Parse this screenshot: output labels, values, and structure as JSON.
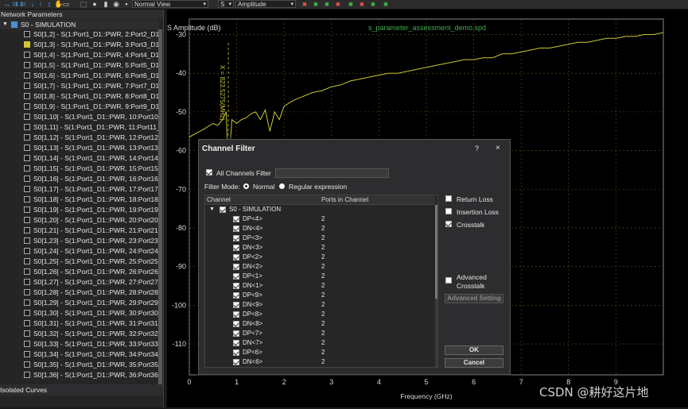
{
  "toolbar": {
    "icons": [
      "arrows-left-right-icon",
      "arrows-right-icon",
      "arrows-left-icon",
      "arrow-down-icon",
      "arrow-up-icon",
      "arrow-up-down-icon",
      "hand-icon",
      "select-box-icon",
      "zoom-box-icon",
      "camera-icon",
      "chart-icon",
      "plot-icon",
      "marker-icon",
      "layout-icon",
      "table-icon",
      "export-icon"
    ],
    "view_select": "Normal View",
    "param_select": "S",
    "measure_select": "Amplitude"
  },
  "left_panel": {
    "title": "Network Parameters",
    "root_label": "S0 - SIMULATION",
    "items": [
      {
        "label": "S0[1,2] - S(1:Port1_D1::PWR, 2:Port2_D1_...",
        "checked": false
      },
      {
        "label": "S0[1,3] - S(1:Port1_D1::PWR, 3:Port3_D1_...",
        "checked": true
      },
      {
        "label": "S0[1,4] - S(1:Port1_D1::PWR, 4:Port4_D1_...",
        "checked": false
      },
      {
        "label": "S0[1,5] - S(1:Port1_D1::PWR, 5:Port5_D1_...",
        "checked": false
      },
      {
        "label": "S0[1,6] - S(1:Port1_D1::PWR, 6:Port6_D1_...",
        "checked": false
      },
      {
        "label": "S0[1,7] - S(1:Port1_D1::PWR, 7:Port7_D1_...",
        "checked": false
      },
      {
        "label": "S0[1,8] - S(1:Port1_D1::PWR, 8:Port8_D1_...",
        "checked": false
      },
      {
        "label": "S0[1,9] - S(1:Port1_D1::PWR, 9:Port9_D1_...",
        "checked": false
      },
      {
        "label": "S0[1,10] - S(1:Port1_D1::PWR, 10:Port10_...",
        "checked": false
      },
      {
        "label": "S0[1,11] - S(1:Port1_D1::PWR, 11:Port11_...",
        "checked": false
      },
      {
        "label": "S0[1,12] - S(1:Port1_D1::PWR, 12:Port12_...",
        "checked": false
      },
      {
        "label": "S0[1,13] - S(1:Port1_D1::PWR, 13:Port13_...",
        "checked": false
      },
      {
        "label": "S0[1,14] - S(1:Port1_D1::PWR, 14:Port14_...",
        "checked": false
      },
      {
        "label": "S0[1,15] - S(1:Port1_D1::PWR, 15:Port15_...",
        "checked": false
      },
      {
        "label": "S0[1,16] - S(1:Port1_D1::PWR, 16:Port16_...",
        "checked": false
      },
      {
        "label": "S0[1,17] - S(1:Port1_D1::PWR, 17:Port17_...",
        "checked": false
      },
      {
        "label": "S0[1,18] - S(1:Port1_D1::PWR, 18:Port18_...",
        "checked": false
      },
      {
        "label": "S0[1,19] - S(1:Port1_D1::PWR, 19:Port19_...",
        "checked": false
      },
      {
        "label": "S0[1,20] - S(1:Port1_D1::PWR, 20:Port20_...",
        "checked": false
      },
      {
        "label": "S0[1,21] - S(1:Port1_D1::PWR, 21:Port21_...",
        "checked": false
      },
      {
        "label": "S0[1,23] - S(1:Port1_D1::PWR, 23:Port23_...",
        "checked": false
      },
      {
        "label": "S0[1,24] - S(1:Port1_D1::PWR, 24:Port24_...",
        "checked": false
      },
      {
        "label": "S0[1,25] - S(1:Port1_D1::PWR, 25:Port25_...",
        "checked": false
      },
      {
        "label": "S0[1,26] - S(1:Port1_D1::PWR, 26:Port26_...",
        "checked": false
      },
      {
        "label": "S0[1,27] - S(1:Port1_D1::PWR, 27:Port27_...",
        "checked": false
      },
      {
        "label": "S0[1,28] - S(1:Port1_D1::PWR, 28:Port28_...",
        "checked": false
      },
      {
        "label": "S0[1,29] - S(1:Port1_D1::PWR, 29:Port29_...",
        "checked": false
      },
      {
        "label": "S0[1,30] - S(1:Port1_D1::PWR, 30:Port30_...",
        "checked": false
      },
      {
        "label": "S0[1,31] - S(1:Port1_D1::PWR, 31:Port31_...",
        "checked": false
      },
      {
        "label": "S0[1,32] - S(1:Port1_D1::PWR, 32:Port32_...",
        "checked": false
      },
      {
        "label": "S0[1,33] - S(1:Port1_D1::PWR, 33:Port33_...",
        "checked": false
      },
      {
        "label": "S0[1,34] - S(1:Port1_D1::PWR, 34:Port34_...",
        "checked": false
      },
      {
        "label": "S0[1,35] - S(1:Port1_D1::PWR, 35:Port35_...",
        "checked": false
      },
      {
        "label": "S0[1,36] - S(1:Port1_D1::PWR, 36:Port36_...",
        "checked": false
      }
    ],
    "isolated_title": "Isolated Curves"
  },
  "plot": {
    "ylabel": "S Amplitude (dB)",
    "xlabel": "Frequency (GHz)",
    "file_title": "s_parameter_assessment_demo.spd",
    "marker_label": "X = 823.5275(MHz)"
  },
  "chart_data": {
    "type": "line",
    "title": "s_parameter_assessment_demo.spd",
    "xlabel": "Frequency (GHz)",
    "ylabel": "S Amplitude (dB)",
    "xlim": [
      0,
      10
    ],
    "ylim": [
      -118,
      -26
    ],
    "x_ticks": [
      0,
      1,
      2,
      3,
      4,
      5,
      6,
      7,
      8,
      9
    ],
    "y_ticks": [
      -30,
      -40,
      -50,
      -60,
      -70,
      -80,
      -90,
      -100,
      -110
    ],
    "grid": true,
    "marker_x": 0.8235,
    "series": [
      {
        "color": "#c8c832",
        "x": [
          0.0,
          0.3,
          0.5,
          0.6,
          0.7,
          0.78,
          0.82,
          0.9,
          1.0,
          1.1,
          1.2,
          1.3,
          1.4,
          1.5,
          1.6,
          1.7,
          1.8,
          1.9,
          2.0,
          2.2,
          2.4,
          2.6,
          2.8,
          3.0,
          3.2,
          3.4,
          3.6,
          3.8,
          4.0,
          4.2,
          4.4,
          4.6,
          4.8,
          5.0,
          5.2,
          5.4,
          5.6,
          5.8,
          6.0,
          6.2,
          6.4,
          6.6,
          6.8,
          7.0,
          7.2,
          7.4,
          7.6,
          7.8,
          8.0,
          8.2,
          8.4,
          8.6,
          8.8,
          9.0,
          9.2,
          9.4,
          9.6,
          9.8,
          10.0
        ],
        "values": [
          -56.5,
          -54.5,
          -53,
          -53.5,
          -52,
          -50,
          -66,
          -52,
          -53,
          -52,
          -51.5,
          -50.5,
          -50,
          -52,
          -49.5,
          -55,
          -50,
          -52,
          -48.5,
          -47,
          -46,
          -45,
          -44.5,
          -43.5,
          -43,
          -42,
          -41.5,
          -41,
          -40.5,
          -40,
          -40,
          -39.5,
          -39,
          -38.5,
          -38,
          -37.5,
          -37,
          -36.5,
          -36.5,
          -36,
          -36,
          -35,
          -35,
          -34.5,
          -34,
          -33.5,
          -33.5,
          -33,
          -32.5,
          -32,
          -32,
          -31.5,
          -31,
          -31,
          -30.5,
          -30.5,
          -30,
          -30,
          -29.5
        ]
      }
    ]
  },
  "dialog": {
    "title": "Channel Filter",
    "help": "?",
    "close": "×",
    "all_channels_label": "All Channels",
    "all_channels_checked": true,
    "filter_label": "Filter",
    "filter_value": "",
    "filter_mode_label": "Filter Mode:",
    "mode_normal": "Normal",
    "mode_regex": "Regular expression",
    "col_channel": "Channel",
    "col_ports": "Ports in Channel",
    "group_label": "S0 - SIMULATION",
    "rows": [
      {
        "name": "DP<4>",
        "ports": "2"
      },
      {
        "name": "DN<4>",
        "ports": "2"
      },
      {
        "name": "DP<3>",
        "ports": "2"
      },
      {
        "name": "DN<3>",
        "ports": "2"
      },
      {
        "name": "DP<2>",
        "ports": "2"
      },
      {
        "name": "DN<2>",
        "ports": "2"
      },
      {
        "name": "DP<1>",
        "ports": "2"
      },
      {
        "name": "DN<1>",
        "ports": "2"
      },
      {
        "name": "DP<9>",
        "ports": "2"
      },
      {
        "name": "DN<9>",
        "ports": "2"
      },
      {
        "name": "DP<8>",
        "ports": "2"
      },
      {
        "name": "DN<8>",
        "ports": "2"
      },
      {
        "name": "DP<7>",
        "ports": "2"
      },
      {
        "name": "DN<7>",
        "ports": "2"
      },
      {
        "name": "DP<6>",
        "ports": "2"
      },
      {
        "name": "DN<6>",
        "ports": "2"
      }
    ],
    "options": {
      "return_loss": {
        "label": "Return Loss",
        "checked": false
      },
      "insertion_loss": {
        "label": "Insertion Loss",
        "checked": false
      },
      "crosstalk": {
        "label": "Crosstalk",
        "checked": true
      },
      "advanced_crosstalk": {
        "label_line1": "Advanced",
        "label_line2": "Crosstalk",
        "checked": false
      }
    },
    "advanced_setting": "Advanced Setting",
    "ok": "OK",
    "cancel": "Cancel"
  },
  "watermark": "CSDN @耕好这片地"
}
